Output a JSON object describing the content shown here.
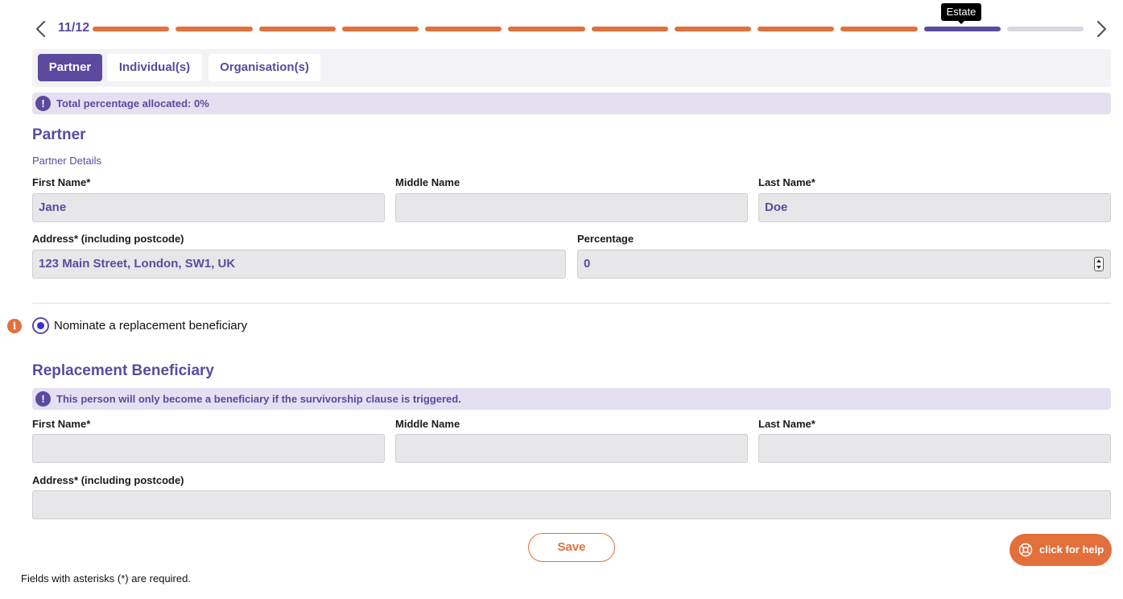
{
  "progress": {
    "counter": "11/12",
    "tooltip": "Estate",
    "steps": [
      "done",
      "done",
      "done",
      "done",
      "done",
      "done",
      "done",
      "done",
      "done",
      "done",
      "current",
      "todo"
    ]
  },
  "tabs": [
    {
      "label": "Partner",
      "active": true
    },
    {
      "label": "Individual(s)",
      "active": false
    },
    {
      "label": "Organisation(s)",
      "active": false
    }
  ],
  "allocation_notice": {
    "icon": "exclamation-icon",
    "text": "Total percentage allocated: 0%"
  },
  "partner": {
    "heading": "Partner",
    "subheading": "Partner Details",
    "first_name": {
      "label": "First Name*",
      "value": "Jane"
    },
    "middle_name": {
      "label": "Middle Name",
      "value": ""
    },
    "last_name": {
      "label": "Last Name*",
      "value": "Doe"
    },
    "address": {
      "label": "Address* (including postcode)",
      "value": "123 Main Street, London, SW1, UK"
    },
    "percentage": {
      "label": "Percentage",
      "value": "0"
    }
  },
  "replacement_option": {
    "label": "Nominate a replacement beneficiary",
    "selected": true
  },
  "replacement": {
    "heading": "Replacement Beneficiary",
    "notice": "This person will only become a beneficiary if the survivorship clause is triggered.",
    "first_name": {
      "label": "First Name*",
      "value": ""
    },
    "middle_name": {
      "label": "Middle Name",
      "value": ""
    },
    "last_name": {
      "label": "Last Name*",
      "value": ""
    },
    "address": {
      "label": "Address* (including postcode)",
      "value": ""
    }
  },
  "save_label": "Save",
  "help_label": "click for help",
  "footnote": "Fields with asterisks (*) are required.",
  "colors": {
    "accent": "#5b4a9e",
    "brand_orange": "#e36f3c",
    "notice_bg": "#e4e0f2"
  }
}
